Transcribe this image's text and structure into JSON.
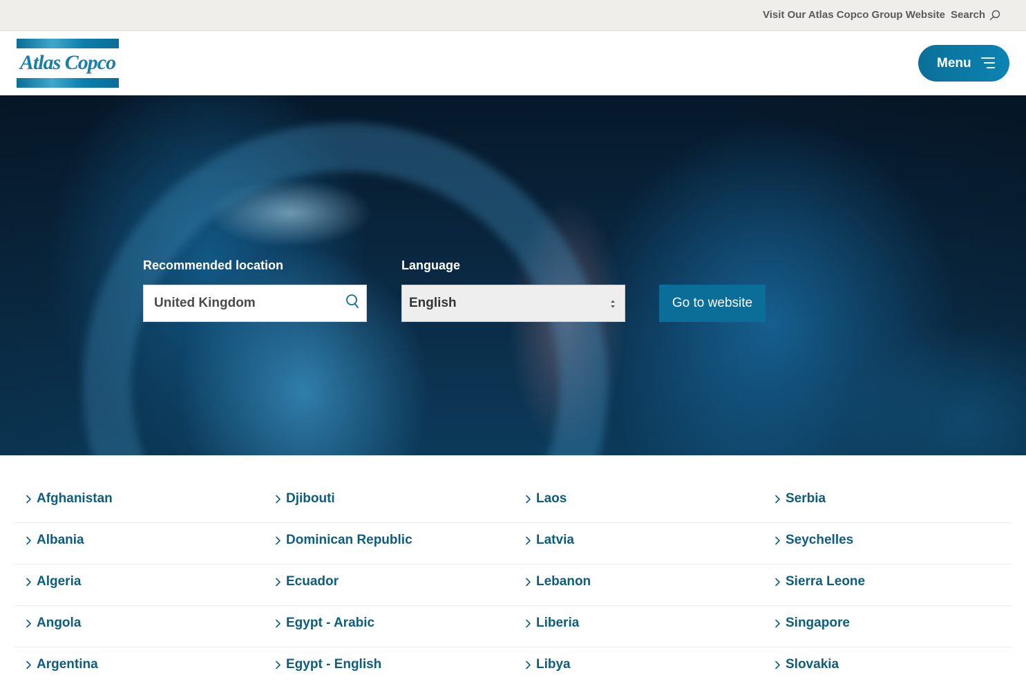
{
  "topbar": {
    "group_link": "Visit Our Atlas Copco Group Website",
    "search_label": "Search"
  },
  "header": {
    "logo_text": "Atlas Copco",
    "menu_label": "Menu"
  },
  "hero": {
    "location_label": "Recommended location",
    "location_value": "United Kingdom",
    "language_label": "Language",
    "language_value": "English",
    "cta_label": "Go to website"
  },
  "countries": {
    "rows": [
      [
        "Afghanistan",
        "Djibouti",
        "Laos",
        "Serbia"
      ],
      [
        "Albania",
        "Dominican Republic",
        "Latvia",
        "Seychelles"
      ],
      [
        "Algeria",
        "Ecuador",
        "Lebanon",
        "Sierra Leone"
      ],
      [
        "Angola",
        "Egypt - Arabic",
        "Liberia",
        "Singapore"
      ],
      [
        "Argentina",
        "Egypt - English",
        "Libya",
        "Slovakia"
      ]
    ]
  },
  "colors": {
    "brand_blue": "#0b6e99",
    "link_blue": "#0c5d7e",
    "topbar_bg": "#efeeea"
  }
}
